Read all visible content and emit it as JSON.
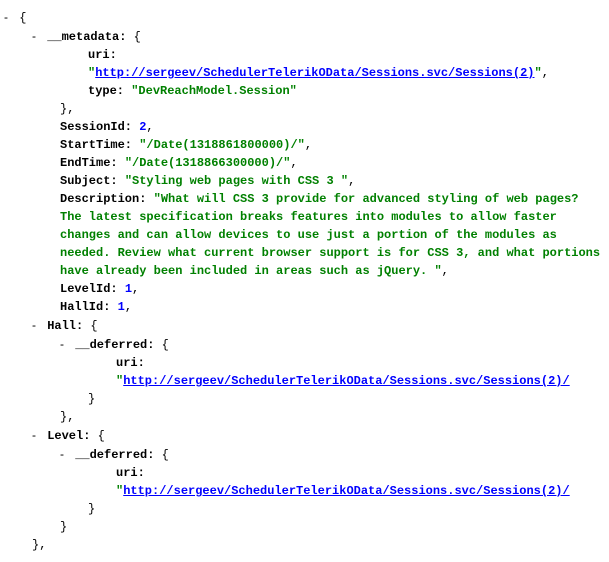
{
  "root": {
    "metadata_key": "__metadata:",
    "metadata_uri_key": "uri:",
    "metadata_uri_val": "http://sergeev/SchedulerTelerikOData/Sessions.svc/Sessions(2)",
    "metadata_type_key": "type:",
    "metadata_type_val": "\"DevReachModel.Session\"",
    "sessionid_key": "SessionId:",
    "sessionid_val": "2",
    "starttime_key": "StartTime:",
    "starttime_val": "\"/Date(1318861800000)/\"",
    "endtime_key": "EndTime:",
    "endtime_val": "\"/Date(1318866300000)/\"",
    "subject_key": "Subject:",
    "subject_val": "\"Styling web pages with CSS 3 \"",
    "description_key": "Description:",
    "description_val": "\"What will CSS 3 provide for advanced styling of web pages? The latest specification breaks features into modules to allow faster changes and can allow devices to use just a portion of the modules as needed. Review what current browser support is for CSS 3, and what portions have already been included in areas such as jQuery. \"",
    "levelid_key": "LevelId:",
    "levelid_val": "1",
    "hallid_key": "HallId:",
    "hallid_val": "1",
    "hall_key": "Hall:",
    "deferred_key": "__deferred:",
    "uri_key": "uri:",
    "hall_uri_val": "http://sergeev/SchedulerTelerikOData/Sessions.svc/Sessions(2)/",
    "level_key": "Level:",
    "level_uri_val": "http://sergeev/SchedulerTelerikOData/Sessions.svc/Sessions(2)/",
    "open_brace": "{",
    "close_brace": "}",
    "close_brace_comma": "},",
    "comma": ",",
    "quote": "\"",
    "dash": "-"
  }
}
